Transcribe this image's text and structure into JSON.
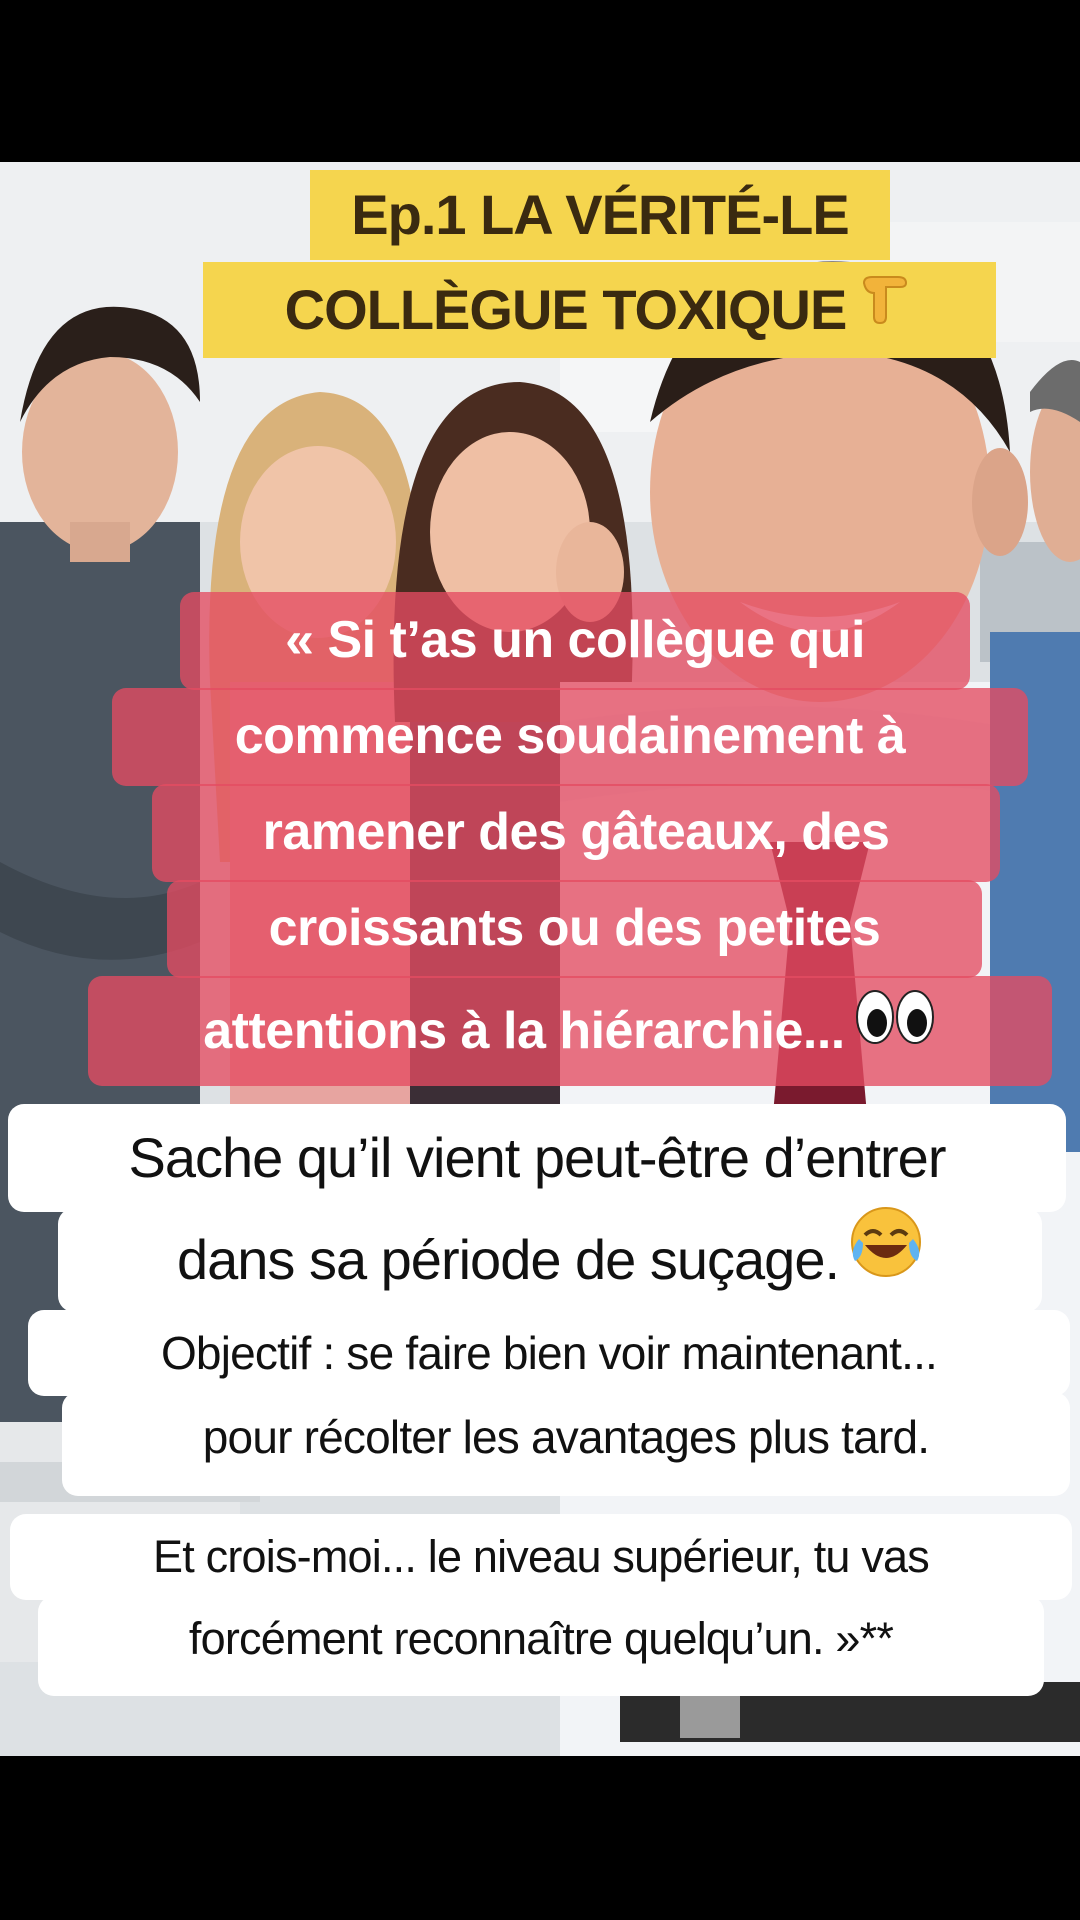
{
  "title": {
    "line1": "Ep.1 LA VÉRITÉ-LE",
    "line2": "COLLÈGUE  TOXIQUE",
    "emoji": "pointing-down-hand-icon"
  },
  "quote": {
    "lines": [
      "« Si t’as un collègue qui",
      "commence soudainement à",
      "ramener des gâteaux, des",
      "croissants ou des petites",
      "attentions à la hiérarchie..."
    ],
    "emoji": "eyes-icon"
  },
  "punchline": {
    "lines": [
      "Sache qu’il vient peut-être d’entrer",
      "dans sa période de suçage."
    ],
    "emoji": "tears-of-joy-icon"
  },
  "objective": {
    "lines": [
      "Objectif : se faire bien voir maintenant...",
      "pour récolter les avantages plus tard."
    ]
  },
  "closing": {
    "lines": [
      "Et crois-moi... le niveau supérieur, tu vas",
      "forcément reconnaître quelqu’un. »**"
    ]
  },
  "colors": {
    "title_bg": "#f5d54e",
    "quote_bg": "#e44c62",
    "caption_bg": "#ffffff"
  }
}
